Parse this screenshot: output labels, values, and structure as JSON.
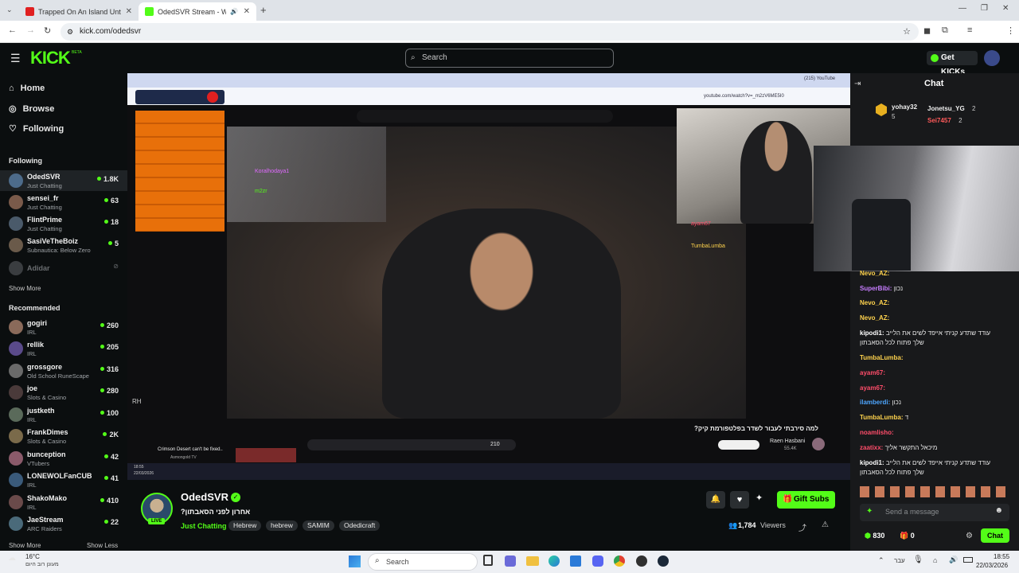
{
  "browser": {
    "tabs": [
      {
        "title": "Trapped On An Island Until I Bu",
        "active": false
      },
      {
        "title": "OdedSVR Stream - Watch l",
        "active": true
      }
    ],
    "url": "kick.com/odedsvr"
  },
  "header": {
    "logo": "KICK",
    "logo_badge": "BETA",
    "search_placeholder": "Search",
    "get_kicks": "Get KICKs"
  },
  "sidebar": {
    "nav": [
      {
        "label": "Home",
        "icon": "home-icon"
      },
      {
        "label": "Browse",
        "icon": "compass-icon"
      },
      {
        "label": "Following",
        "icon": "heart-icon"
      }
    ],
    "following_title": "Following",
    "following": [
      {
        "name": "OdedSVR",
        "category": "Just Chatting",
        "viewers": "1.8K"
      },
      {
        "name": "sensei_fr",
        "category": "Just Chatting",
        "viewers": "63"
      },
      {
        "name": "FlintPrime",
        "category": "Just Chatting",
        "viewers": "18"
      },
      {
        "name": "SasiVeTheBoiz",
        "category": "Subnautica: Below Zero",
        "viewers": "5"
      },
      {
        "name": "Adidar",
        "category": "",
        "viewers": ""
      }
    ],
    "show_more": "Show More",
    "recommended_title": "Recommended",
    "recommended": [
      {
        "name": "gogiri",
        "category": "IRL",
        "viewers": "260"
      },
      {
        "name": "rellik",
        "category": "IRL",
        "viewers": "205"
      },
      {
        "name": "grossgore",
        "category": "Old School RuneScape",
        "viewers": "316"
      },
      {
        "name": "joe",
        "category": "Slots & Casino",
        "viewers": "280"
      },
      {
        "name": "justketh",
        "category": "IRL",
        "viewers": "100"
      },
      {
        "name": "FrankDimes",
        "category": "Slots & Casino",
        "viewers": "2K"
      },
      {
        "name": "bunception",
        "category": "VTubers",
        "viewers": "42"
      },
      {
        "name": "LONEWOLFanCUB",
        "category": "IRL",
        "viewers": "41"
      },
      {
        "name": "ShakoMako",
        "category": "IRL",
        "viewers": "410"
      },
      {
        "name": "JaeStream",
        "category": "ARC Raiders",
        "viewers": "22"
      }
    ],
    "show_more_2": "Show More",
    "show_less": "Show Less"
  },
  "video": {
    "inner_url": "youtube.com/watch?v=_m2zV6ME5I0",
    "inner_tab_label": "(215) YouTube",
    "inner_title": "למה סירבתי לעבור לשדר בפלטפורמת קיק?",
    "inner_channel": "Raen Hasbani",
    "inner_channel_subs": "55.4K",
    "inner_likes": "210",
    "inner_recommend": "Crimson Desert can't be fixed..",
    "inner_recommend_channel": "Asmongold TV",
    "inner_chat_users": [
      "Koralhodaya1",
      "m2zr",
      "ayam67",
      "TumbaLumba"
    ],
    "inner_date": "22/03/2026",
    "inner_time": "18:55",
    "overlay_badge": "RH"
  },
  "channel": {
    "name": "OdedSVR",
    "title": "?אחרון לפני הסאבתון",
    "live": "LIVE",
    "category": "Just Chatting",
    "tags": [
      "Hebrew",
      "hebrew",
      "SAMIM",
      "Odedicraft"
    ],
    "gift_subs": "Gift Subs",
    "viewers": "1,784",
    "viewers_label": "Viewers"
  },
  "chat": {
    "title": "Chat",
    "top_gifters": [
      {
        "name": "yohay32",
        "count": "5"
      },
      {
        "name": "Jonetsu_YG",
        "count": "2"
      },
      {
        "name": "Sei7457",
        "count": "2"
      }
    ],
    "messages": [
      {
        "user": "Nevo_AZ:",
        "text": "",
        "color": "#ffd34d"
      },
      {
        "user": "SuperBibi:",
        "text": "נכון",
        "color": "#c77dff"
      },
      {
        "user": "Nevo_AZ:",
        "text": "",
        "color": "#ffd34d"
      },
      {
        "user": "Nevo_AZ:",
        "text": "",
        "color": "#ffd34d"
      },
      {
        "user": "kipodi1:",
        "text": "עודד שתדע קניתי אייפד לשים את הלייב",
        "color": "#ffffff"
      },
      {
        "user": "",
        "text": "שלך פתוח לכל הסאבתון",
        "color": "#ffffff"
      },
      {
        "user": "TumbaLumba:",
        "text": "",
        "color": "#ffd34d"
      },
      {
        "user": "ayam67:",
        "text": "",
        "color": "#ff4d6a"
      },
      {
        "user": "ayam67:",
        "text": "",
        "color": "#ff4d6a"
      },
      {
        "user": "ilamberdi:",
        "text": "נכון",
        "color": "#4da6ff"
      },
      {
        "user": "TumbaLumba:",
        "text": "ד",
        "color": "#ffd34d"
      },
      {
        "user": "noamlisho:",
        "text": "",
        "color": "#ff4d6a"
      },
      {
        "user": "zaatixx:",
        "text": "מיכאל התקשר אליך",
        "color": "#ff4d6a"
      },
      {
        "user": "kipodi1:",
        "text": "עודד שתדע קניתי אייפד לשים את הלייב",
        "color": "#ffffff"
      },
      {
        "user": "",
        "text": "שלך פתוח לכל הסאבתון",
        "color": "#ffffff"
      }
    ],
    "input_placeholder": "Send a message",
    "points": "830",
    "gifts": "0",
    "send_label": "Chat"
  },
  "taskbar": {
    "weather_temp": "16°C",
    "weather_desc": "מעונן רוב היום",
    "search": "Search",
    "lang": "עבר",
    "time": "18:55",
    "date": "22/03/2026"
  },
  "colors": {
    "accent": "#53fc18",
    "background": "#0b0e0f",
    "chat_bg": "#18191b"
  }
}
